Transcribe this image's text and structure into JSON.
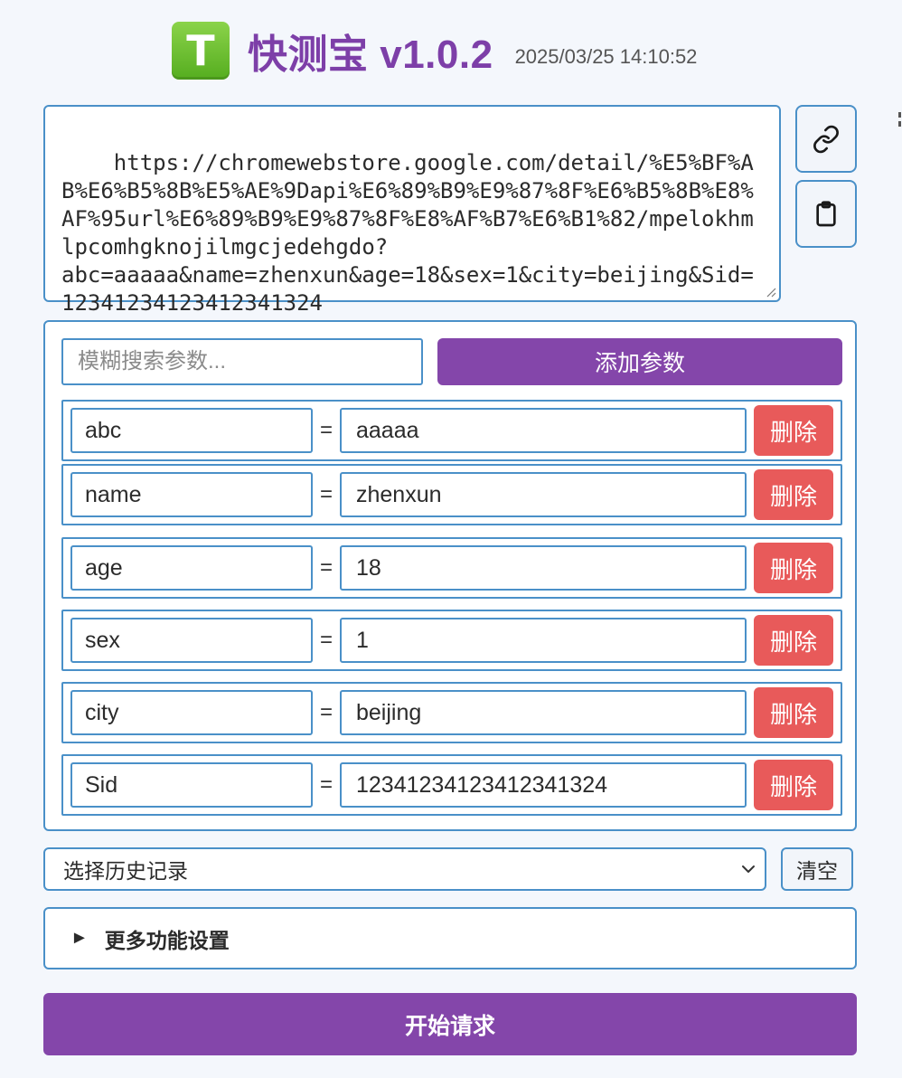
{
  "header": {
    "logo_letter": "T",
    "title": "快测宝 v1.0.2",
    "timestamp": "2025/03/25 14:10:52"
  },
  "url": {
    "value": "https://chromewebstore.google.com/detail/%E5%BF%AB%E6%B5%8B%E5%AE%9Dapi%E6%89%B9%E9%87%8F%E6%B5%8B%E8%AF%95url%E6%89%B9%E9%87%8F%E8%AF%B7%E6%B1%82/mpelokhmlpcomhgknojilmgcjedehgdo?\nabc=aaaaa&name=zhenxun&age=18&sex=1&city=beijing&Sid=12341234123412341324"
  },
  "side_buttons": {
    "link_icon": "link-icon",
    "clipboard_icon": "clipboard-icon"
  },
  "params": {
    "search_placeholder": "模糊搜索参数...",
    "add_label": "添加参数",
    "equals": "=",
    "delete_label": "删除",
    "rows": [
      {
        "key": "abc",
        "value": "aaaaa"
      },
      {
        "key": "name",
        "value": "zhenxun"
      },
      {
        "key": "age",
        "value": "18"
      },
      {
        "key": "sex",
        "value": "1"
      },
      {
        "key": "city",
        "value": "beijing"
      },
      {
        "key": "Sid",
        "value": "12341234123412341324"
      }
    ]
  },
  "history": {
    "selected": "选择历史记录",
    "clear_label": "清空"
  },
  "more_settings": {
    "toggle": "►",
    "label": "更多功能设置"
  },
  "start": {
    "label": "开始请求"
  },
  "colors": {
    "accent": "#8446aa",
    "border": "#4a90c8",
    "danger": "#e85a5a",
    "logo": "#6cc132"
  }
}
